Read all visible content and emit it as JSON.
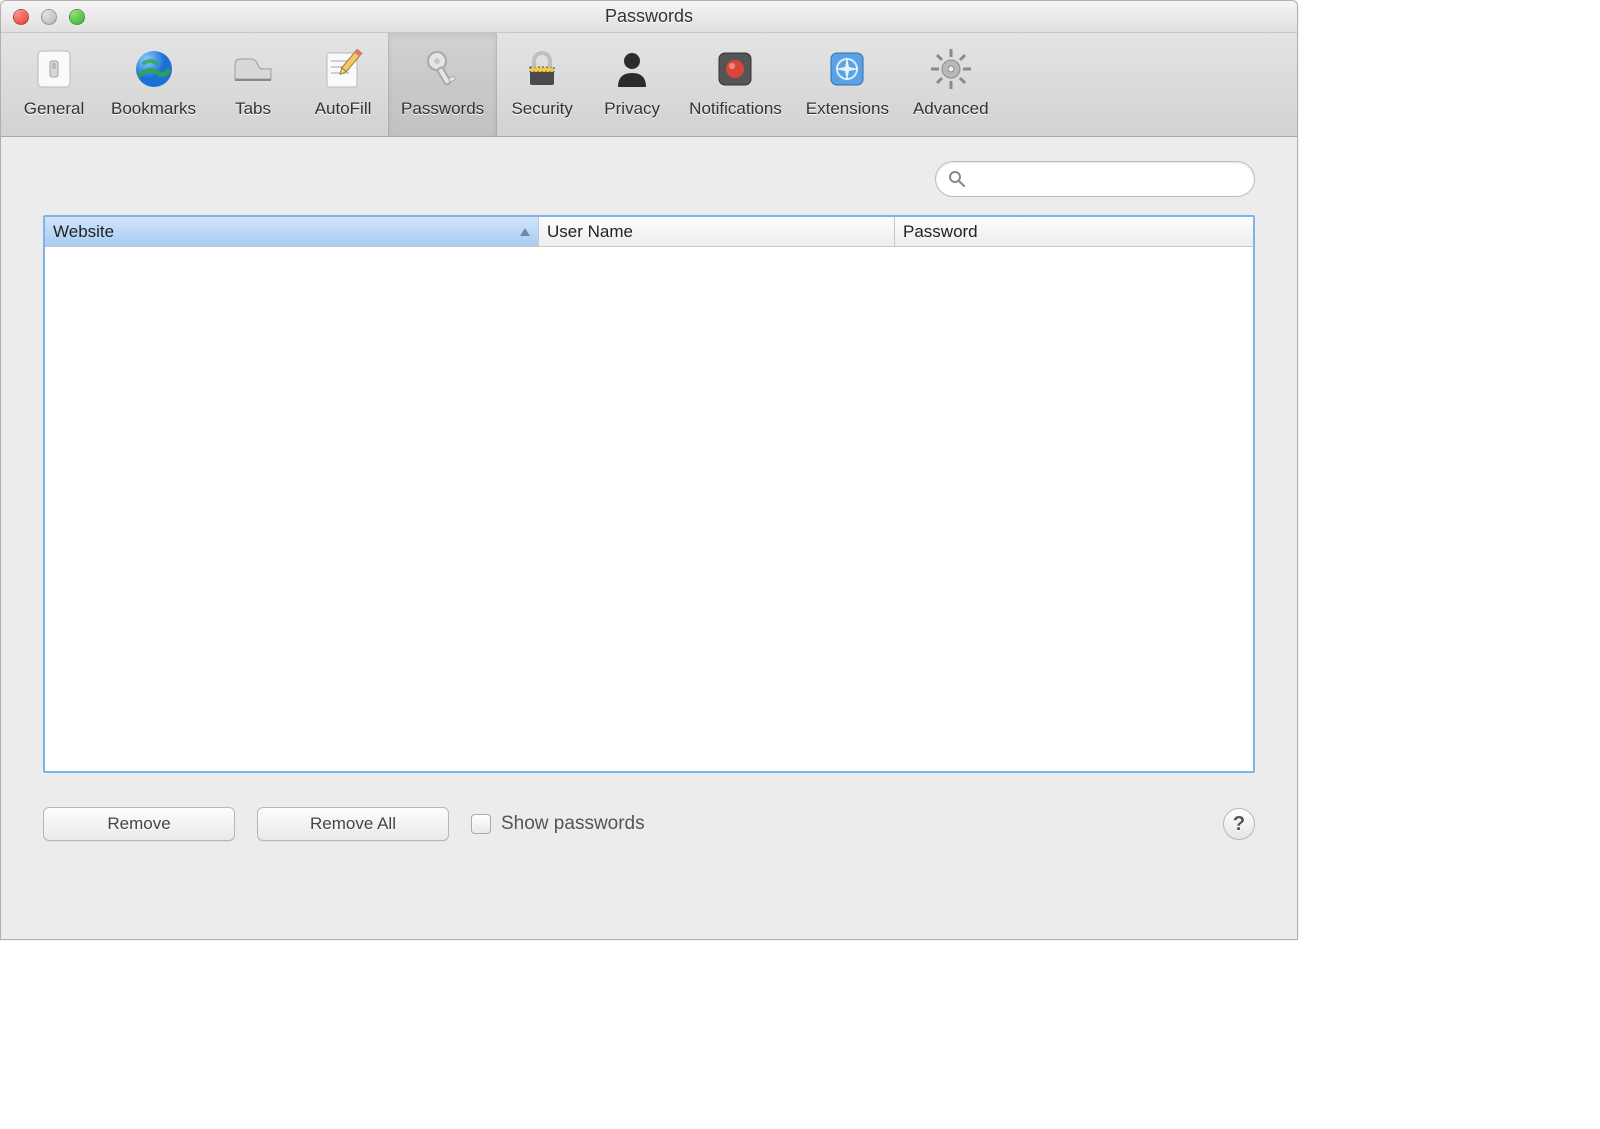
{
  "window": {
    "title": "Passwords"
  },
  "toolbar": [
    {
      "id": "general",
      "label": "General",
      "selected": false
    },
    {
      "id": "bookmarks",
      "label": "Bookmarks",
      "selected": false
    },
    {
      "id": "tabs",
      "label": "Tabs",
      "selected": false
    },
    {
      "id": "autofill",
      "label": "AutoFill",
      "selected": false
    },
    {
      "id": "passwords",
      "label": "Passwords",
      "selected": true
    },
    {
      "id": "security",
      "label": "Security",
      "selected": false
    },
    {
      "id": "privacy",
      "label": "Privacy",
      "selected": false
    },
    {
      "id": "notifications",
      "label": "Notifications",
      "selected": false
    },
    {
      "id": "extensions",
      "label": "Extensions",
      "selected": false
    },
    {
      "id": "advanced",
      "label": "Advanced",
      "selected": false
    }
  ],
  "search": {
    "value": "",
    "placeholder": ""
  },
  "table": {
    "columns": [
      {
        "label": "Website",
        "sorted": "asc"
      },
      {
        "label": "User Name",
        "sorted": null
      },
      {
        "label": "Password",
        "sorted": null
      }
    ],
    "rows": []
  },
  "footer": {
    "remove_label": "Remove",
    "remove_all_label": "Remove All",
    "show_passwords_label": "Show passwords",
    "show_passwords_checked": false,
    "help_label": "?"
  }
}
